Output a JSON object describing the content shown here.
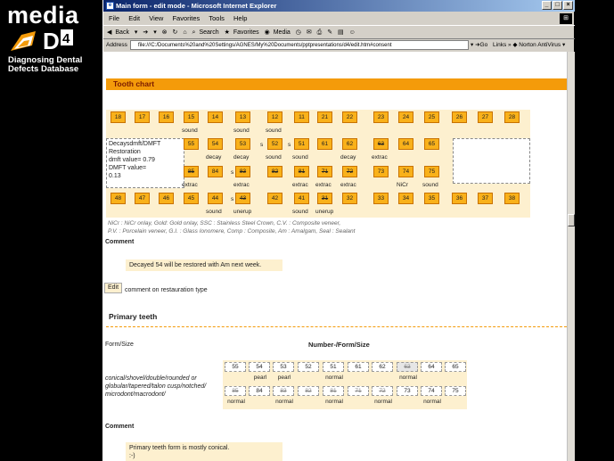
{
  "branding": {
    "media": "media",
    "d4": "D4",
    "subtitle_line1": "Diagnosing Dental",
    "subtitle_line2": "Defects Database"
  },
  "window": {
    "title": "Main form - edit mode - Microsoft Internet Explorer",
    "menu": [
      "File",
      "Edit",
      "View",
      "Favorites",
      "Tools",
      "Help"
    ],
    "toolbar": {
      "back": "Back",
      "search": "Search",
      "favorites": "Favorites",
      "media": "Media"
    },
    "address_label": "Address",
    "address_value": "file:///C:/Documents%20and%20Settings/AGNES/My%20Documents/pptpresentations/d4/edit.htm#consent",
    "go": "Go",
    "links": "Links",
    "norton": "Norton AntiVirus"
  },
  "tooth_chart": {
    "header": "Tooth chart",
    "upper_perm": [
      "18",
      "17",
      "16",
      "15",
      "14",
      "13",
      "12",
      "11",
      "21",
      "22",
      "23",
      "24",
      "25",
      "26",
      "27",
      "28"
    ],
    "upper_perm_cond": {
      "15": "sound",
      "13": "sound",
      "12": "sound"
    },
    "upper_prim": [
      "55",
      "54",
      "53",
      "52",
      "51",
      "61",
      "62",
      "63",
      "64",
      "65"
    ],
    "upper_prim_cond": {
      "54": "decay",
      "53": "decay",
      "52": "sound",
      "51": "sound",
      "62": "decay",
      "63": "extrac"
    },
    "lower_prim": [
      "85",
      "84",
      "83",
      "82",
      "81",
      "71",
      "72",
      "73",
      "74",
      "75"
    ],
    "lower_prim_cond": {
      "85": "extrac",
      "83": "extrac",
      "81": "extrac",
      "71": "extrac",
      "72": "extrac",
      "74": "NiCr",
      "75": "sound"
    },
    "lower_perm": [
      "48",
      "47",
      "46",
      "45",
      "44",
      "43",
      "42",
      "41",
      "31",
      "32",
      "33",
      "34",
      "35",
      "36",
      "37",
      "38"
    ],
    "lower_perm_cond": {
      "44": "sound",
      "43": "unerup",
      "41": "sound",
      "31": "unerup"
    },
    "s_label": "s",
    "dmft": {
      "line1": "Decaysdmft/DMFT",
      "line2": "Restoration",
      "line3": "dmft value= 0.79",
      "line4": "DMFT value=",
      "line5": "0.13"
    },
    "legend_line1": "NiCr : NiCr onlay, Gold: Gold onlay, SSC : Stainless Steel Crown, C.V. : Composite veneer,",
    "legend_line2": "P.V. : Porcelain veneer, G.I. : Glass Ionomere, Comp : Composite, Am : Amalgam, Seal : Sealant"
  },
  "comment1": {
    "label": "Comment",
    "text": "Decayed 54 will be restored with Am next week.",
    "edit_button": "Edit",
    "edit_caption": "comment on restauration type"
  },
  "primary_teeth": {
    "title": "Primary teeth",
    "form_size_label": "Form/Size",
    "table_header": "Number-/Form/Size",
    "options_text_1": "conical/shovel/double/rounded or",
    "options_text_2": "globular/tapered/talon cusp/notched/",
    "options_text_3": "microdont/macrodont/",
    "upper": [
      "55",
      "54",
      "53",
      "52",
      "51",
      "61",
      "62",
      "63",
      "64",
      "65"
    ],
    "upper_form": {
      "54": "pearl",
      "53": "pearl",
      "51": "normal",
      "63": "normal"
    },
    "lower": [
      "85",
      "84",
      "83",
      "82",
      "81",
      "71",
      "72",
      "73",
      "74",
      "75"
    ],
    "lower_form": {
      "85": "normal",
      "83": "normal",
      "81": "normal",
      "72": "normal",
      "74": "normal"
    }
  },
  "comment2": {
    "label": "Comment",
    "line1": "Primary teeth form is mostly conical.",
    "line2": ":-)"
  }
}
